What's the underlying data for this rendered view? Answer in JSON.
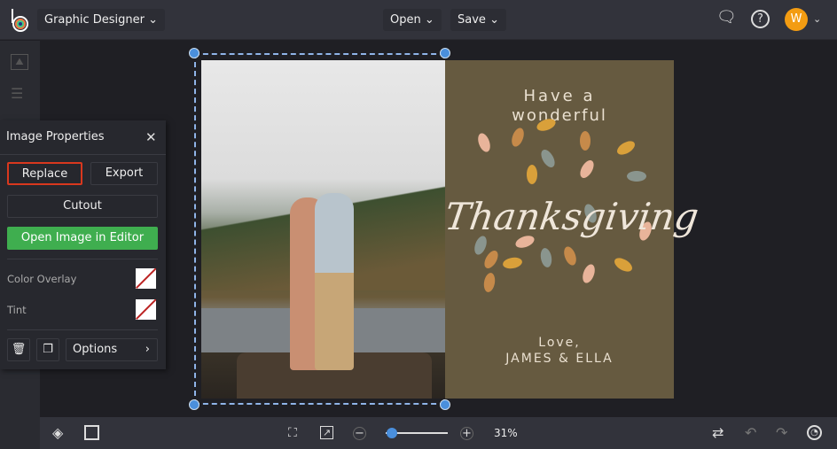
{
  "topbar": {
    "app_menu": "Graphic Designer",
    "open": "Open",
    "save": "Save",
    "avatar_letter": "W",
    "avatar_color": "#f39c12"
  },
  "panel": {
    "title": "Image Properties",
    "replace": "Replace",
    "export": "Export",
    "cutout": "Cutout",
    "open_editor": "Open Image in Editor",
    "color_overlay": "Color Overlay",
    "tint": "Tint",
    "options": "Options"
  },
  "card": {
    "line1": "Have a",
    "line2": "wonderful",
    "script": "Thanksgiving",
    "love": "Love,",
    "names": "JAMES & ELLA",
    "bg": "#665a40",
    "leaf_colors": [
      "#e8b49a",
      "#c68a4a",
      "#d9a03a",
      "#8a958e"
    ]
  },
  "bottombar": {
    "zoom": "31%",
    "zoom_level": 0.1
  }
}
